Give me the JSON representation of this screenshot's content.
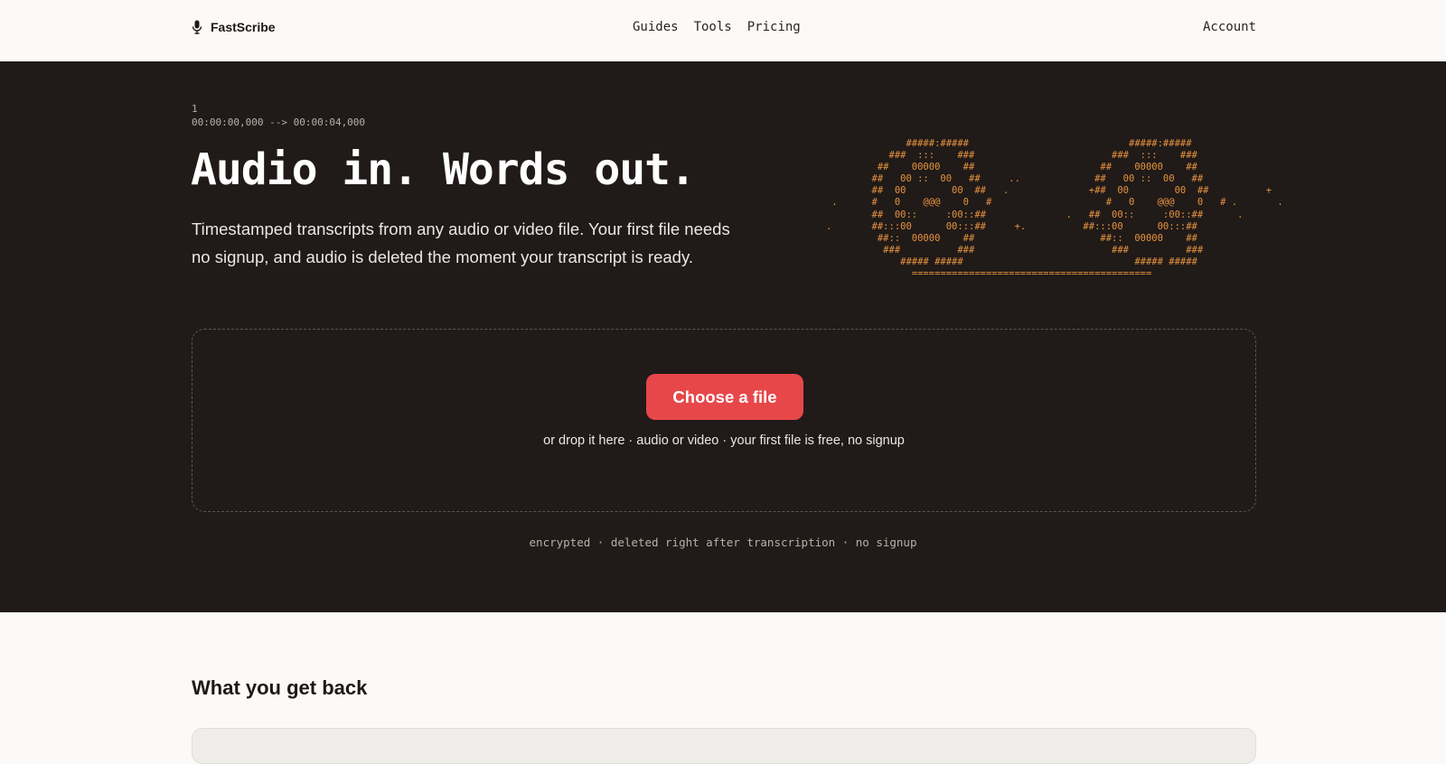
{
  "brand": {
    "name": "FastScribe",
    "icon": "microphone-icon"
  },
  "nav": {
    "items": [
      "Guides",
      "Tools",
      "Pricing"
    ],
    "account": "Account"
  },
  "hero": {
    "cue_index": "1",
    "cue_time": "00:00:00,000 --> 00:00:04,000",
    "headline": "Audio in. Words out.",
    "lede": "Timestamped transcripts from any audio or video file. Your first file needs no signup, and audio is deleted the moment your transcript is ready.",
    "ascii_art": "                 #####:#####                            #####:#####\n              ###  :::    ###                        ###  :::    ###\n            ##    00000    ##                      ##    00000    ##\n           ##   00 ::  00   ##     ..             ##   00 ::  00   ##\n           ##  00        00  ##   .              +##  00        00  ##          +\n    .      #   0    @@@    0   #                    #   0    @@@    0   # .       .\n           ##  00::     :00::##              .   ##  00::     :00::##      .\n   .       ##:::00      00:::##     +.          ##:::00      00:::##\n            ##::  00000    ##                      ##::  00000    ##\n             ###          ###                        ###          ###\n                ##### #####                              ##### #####\n                  ==========================================\n",
    "dropzone": {
      "button": "Choose a file",
      "hint": "or drop it here · audio or video · your first file is free, no signup"
    },
    "trust_line": "encrypted · deleted right after transcription · no signup"
  },
  "section": {
    "title": "What you get back"
  },
  "colors": {
    "hero_bg": "#201a18",
    "accent": "#e8474a",
    "ascii": "#e6933f",
    "page_bg": "#fbfaf8"
  }
}
